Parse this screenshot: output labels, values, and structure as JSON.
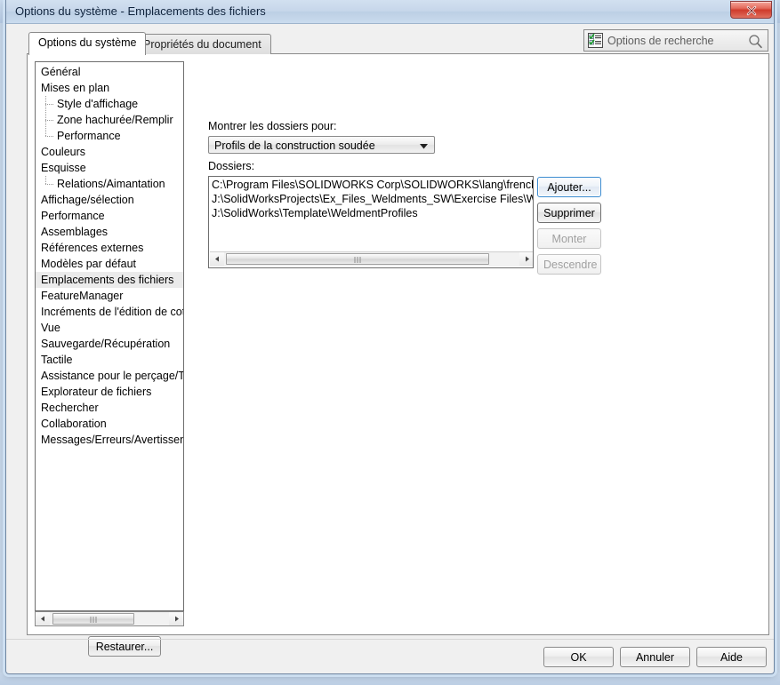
{
  "window": {
    "title": "Options du système - Emplacements des fichiers",
    "close_label": "×",
    "close_icon": "close-icon"
  },
  "background_app": {
    "icon": "app-icon"
  },
  "tabs": [
    {
      "label": "Options du système",
      "active": true
    },
    {
      "label": "Propriétés du document",
      "active": false
    }
  ],
  "search": {
    "label": "Options de recherche",
    "icon": "search-options-icon",
    "magnifier_icon": "magnifier-icon"
  },
  "sidebar": {
    "items": [
      {
        "label": "Général",
        "level": 0,
        "selected": false
      },
      {
        "label": "Mises en plan",
        "level": 0,
        "selected": false
      },
      {
        "label": "Style d'affichage",
        "level": 1,
        "selected": false
      },
      {
        "label": "Zone hachurée/Remplir",
        "level": 1,
        "selected": false
      },
      {
        "label": "Performance",
        "level": 1,
        "selected": false,
        "last": true
      },
      {
        "label": "Couleurs",
        "level": 0,
        "selected": false
      },
      {
        "label": "Esquisse",
        "level": 0,
        "selected": false
      },
      {
        "label": "Relations/Aimantation",
        "level": 1,
        "selected": false,
        "last": true
      },
      {
        "label": "Affichage/sélection",
        "level": 0,
        "selected": false
      },
      {
        "label": "Performance",
        "level": 0,
        "selected": false
      },
      {
        "label": "Assemblages",
        "level": 0,
        "selected": false
      },
      {
        "label": "Références externes",
        "level": 0,
        "selected": false
      },
      {
        "label": "Modèles par défaut",
        "level": 0,
        "selected": false
      },
      {
        "label": "Emplacements des fichiers",
        "level": 0,
        "selected": true
      },
      {
        "label": "FeatureManager",
        "level": 0,
        "selected": false
      },
      {
        "label": "Incréments de l'édition de cot",
        "level": 0,
        "selected": false
      },
      {
        "label": "Vue",
        "level": 0,
        "selected": false
      },
      {
        "label": "Sauvegarde/Récupération",
        "level": 0,
        "selected": false
      },
      {
        "label": "Tactile",
        "level": 0,
        "selected": false
      },
      {
        "label": "Assistance pour le perçage/To",
        "level": 0,
        "selected": false
      },
      {
        "label": "Explorateur de fichiers",
        "level": 0,
        "selected": false
      },
      {
        "label": "Rechercher",
        "level": 0,
        "selected": false
      },
      {
        "label": "Collaboration",
        "level": 0,
        "selected": false
      },
      {
        "label": "Messages/Erreurs/Avertissem",
        "level": 0,
        "selected": false
      }
    ],
    "restore_button": "Restaurer..."
  },
  "main": {
    "show_folders_label": "Montrer les dossiers pour:",
    "category_selected": "Profils de la construction soudée",
    "folders_label": "Dossiers:",
    "folders": [
      "C:\\Program Files\\SOLIDWORKS Corp\\SOLIDWORKS\\lang\\french\\weldm",
      "J:\\SolidWorksProjects\\Ex_Files_Weldments_SW\\Exercise Files\\Weldmen",
      "J:\\SolidWorks\\Template\\WeldmentProfiles"
    ],
    "buttons": [
      {
        "label": "Ajouter...",
        "state": "focused"
      },
      {
        "label": "Supprimer",
        "state": "normal"
      },
      {
        "label": "Monter",
        "state": "disabled"
      },
      {
        "label": "Descendre",
        "state": "disabled"
      }
    ]
  },
  "footer": {
    "ok": "OK",
    "cancel": "Annuler",
    "help": "Aide"
  },
  "colors": {
    "accent": "#3c8bd0",
    "close_red": "#cf3b2c",
    "selection": "#ebebeb",
    "titlebar": "#c6d6ea"
  }
}
